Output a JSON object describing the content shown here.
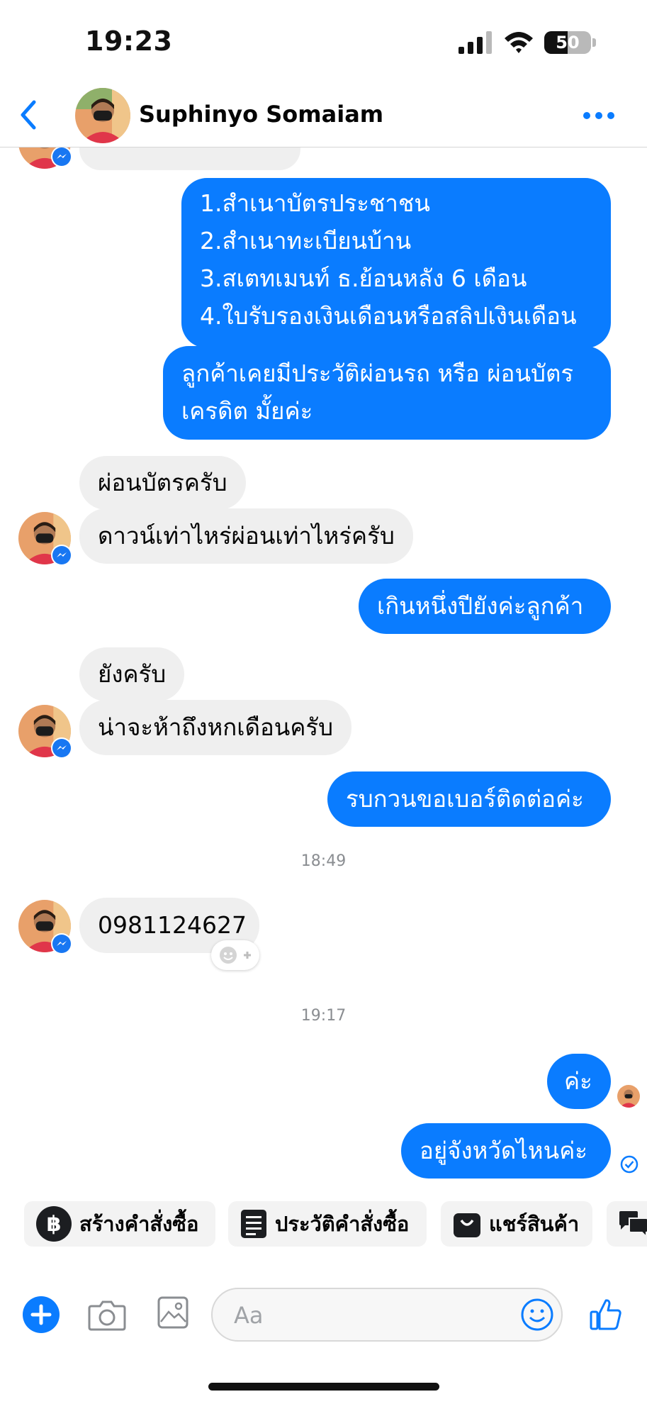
{
  "status_bar": {
    "time": "19:23",
    "battery": "50",
    "battery_level": 0.5
  },
  "header": {
    "contact_name": "Suphinyo Somaiam"
  },
  "messages": {
    "m1": [
      "1.สำเนาบัตรประชาชน",
      "2.สำเนาทะเบียนบ้าน",
      "3.สเตทเมนท์ ธ.ย้อนหลัง 6 เดือน",
      "4.ใบรับรองเงินเดือนหรือสลิปเงินเดือน"
    ],
    "m2": [
      "ลูกค้าเคยมีประวัติผ่อนรถ หรือ ผ่อนบัตร",
      "เครดิต มั้ยค่ะ"
    ],
    "m3": "ผ่อนบัตรครับ",
    "m4": "ดาวน์เท่าไหร่ผ่อนเท่าไหร่ครับ",
    "m5": "เกินหนึ่งปียังค่ะลูกค้า",
    "m6": "ยังครับ",
    "m7": "น่าจะห้าถึงหกเดือนครับ",
    "m8": "รบกวนขอเบอร์ติดต่อค่ะ",
    "ts1": "18:49",
    "m9": "0981124627",
    "ts2": "19:17",
    "m10": "ค่ะ",
    "m11": "อยู่จังหวัดไหนค่ะ"
  },
  "quick_actions": {
    "create_order": "สร้างคำสั่งซื้อ",
    "order_history": "ประวัติคำสั่งซื้อ",
    "share_product": "แชร์สินค้า"
  },
  "composer": {
    "placeholder": "Aa"
  },
  "colors": {
    "accent": "#0a7cff",
    "incoming_bubble": "#efefef"
  }
}
